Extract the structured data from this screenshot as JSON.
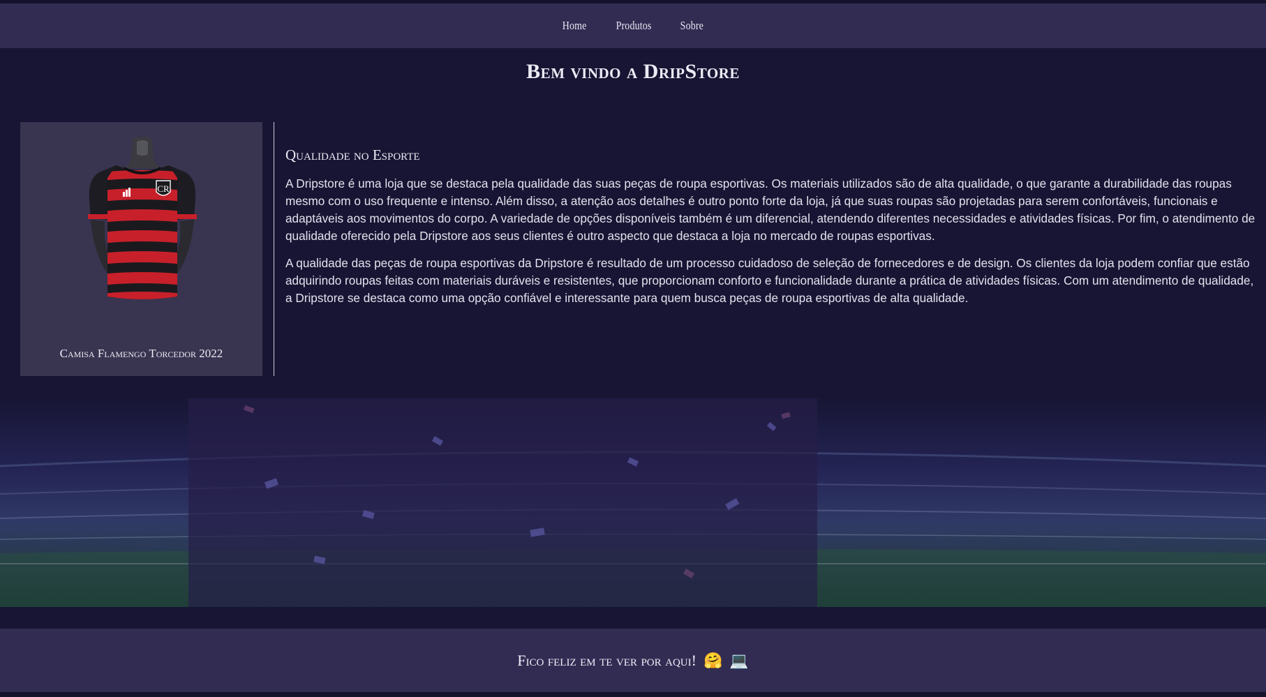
{
  "nav": {
    "items": [
      {
        "label": "Home"
      },
      {
        "label": "Produtos"
      },
      {
        "label": "Sobre"
      }
    ]
  },
  "page": {
    "title": "Bem vindo a DripStore"
  },
  "product": {
    "name": "Camisa Flamengo Torcedor 2022",
    "colors": {
      "red": "#c8202a",
      "black": "#1a1a1e"
    }
  },
  "article": {
    "heading": "Qualidade no Esporte",
    "paragraphs": [
      "A Dripstore é uma loja que se destaca pela qualidade das suas peças de roupa esportivas. Os materiais utilizados são de alta qualidade, o que garante a durabilidade das roupas mesmo com o uso frequente e intenso. Além disso, a atenção aos detalhes é outro ponto forte da loja, já que suas roupas são projetadas para serem confortáveis, funcionais e adaptáveis aos movimentos do corpo. A variedade de opções disponíveis também é um diferencial, atendendo diferentes necessidades e atividades físicas. Por fim, o atendimento de qualidade oferecido pela Dripstore aos seus clientes é outro aspecto que destaca a loja no mercado de roupas esportivas.",
      "A qualidade das peças de roupa esportivas da Dripstore é resultado de um processo cuidadoso de seleção de fornecedores e de design. Os clientes da loja podem confiar que estão adquirindo roupas feitas com materiais duráveis e resistentes, que proporcionam conforto e funcionalidade durante a prática de atividades físicas. Com um atendimento de qualidade, a Dripstore se destaca como uma opção confiável e interessante para quem busca peças de roupa esportivas de alta qualidade."
    ]
  },
  "footer": {
    "message": "Fico feliz em te ver por aqui!",
    "emoji_1": "🤗",
    "emoji_2": "💻"
  },
  "theme": {
    "background": "#171533",
    "navbar": "#322c53",
    "card": "#393450"
  }
}
